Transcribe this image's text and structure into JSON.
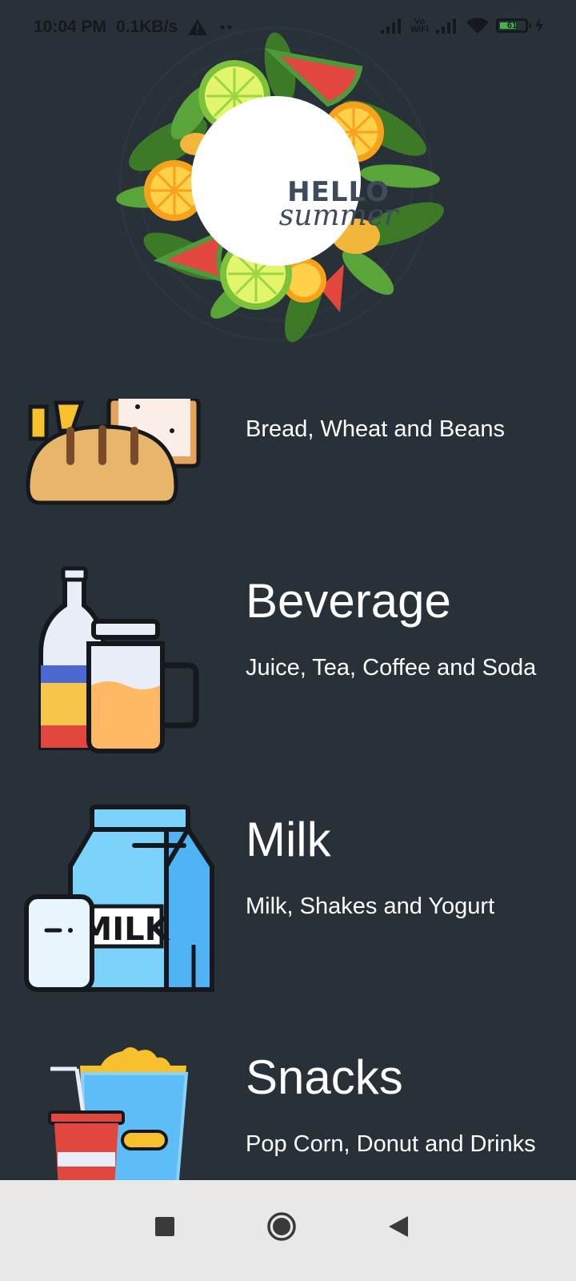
{
  "status_bar": {
    "time": "10:04 PM",
    "network_speed": "0.1KB/s",
    "vowifi_line1": "Vo",
    "vowifi_line2": "WiFi",
    "battery_level": "61",
    "icons": [
      "warning-icon",
      "more-dots-icon",
      "signal-icon",
      "vowifi-icon",
      "signal-icon",
      "wifi-icon",
      "battery-icon",
      "charging-icon"
    ]
  },
  "banner": {
    "line1": "HELLO",
    "line2": "summer"
  },
  "categories": [
    {
      "title": "",
      "subtitle": "Bread, Wheat and Beans",
      "icon": "bread-icon"
    },
    {
      "title": "Beverage",
      "subtitle": "Juice, Tea, Coffee and Soda",
      "icon": "beverage-icon"
    },
    {
      "title": "Milk",
      "subtitle": "Milk, Shakes and Yogurt",
      "icon": "milk-carton-icon"
    },
    {
      "title": "Snacks",
      "subtitle": "Pop Corn, Donut and Drinks",
      "icon": "popcorn-soda-icon"
    }
  ],
  "navigation": {
    "buttons": [
      "recents-button",
      "home-button",
      "back-button"
    ]
  },
  "colors": {
    "background": "#283038",
    "text": "#ffffff",
    "nav_bar": "#e8e8e8",
    "status_text": "#15191e"
  }
}
